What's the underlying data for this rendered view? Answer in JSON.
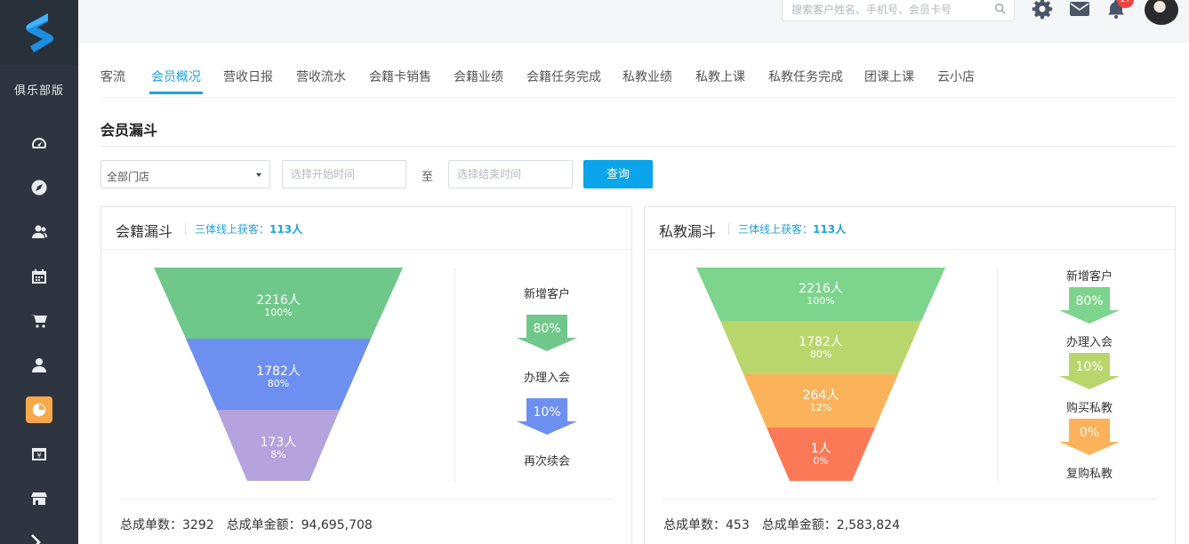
{
  "sidebar": {
    "brand": "俱乐部版",
    "items": [
      {
        "icon": "dashboard-icon"
      },
      {
        "icon": "compass-icon"
      },
      {
        "icon": "users-icon"
      },
      {
        "icon": "calendar-icon"
      },
      {
        "icon": "cart-icon"
      },
      {
        "icon": "user-icon"
      },
      {
        "icon": "report-icon",
        "active": true
      },
      {
        "icon": "finance-icon"
      },
      {
        "icon": "store-icon"
      }
    ]
  },
  "topbar": {
    "search_placeholder": "搜索客户姓名、手机号、会员卡号",
    "badge": "17"
  },
  "tabs": [
    {
      "label": "客流"
    },
    {
      "label": "会员概况",
      "active": true
    },
    {
      "label": "营收日报"
    },
    {
      "label": "营收流水"
    },
    {
      "label": "会籍卡销售"
    },
    {
      "label": "会籍业绩"
    },
    {
      "label": "会籍任务完成"
    },
    {
      "label": "私教业绩"
    },
    {
      "label": "私教上课"
    },
    {
      "label": "私教任务完成"
    },
    {
      "label": "团课上课"
    },
    {
      "label": "云小店"
    }
  ],
  "section_title": "会员漏斗",
  "filters": {
    "store_select": "全部门店",
    "start_placeholder": "选择开始时间",
    "to": "至",
    "end_placeholder": "选择结束时间",
    "query_button": "查询"
  },
  "membership_funnel": {
    "title": "会籍漏斗",
    "subtitle_label": "三体线上获客：",
    "subtitle_value": "113人",
    "segments": [
      {
        "count": "2216人",
        "percent": "100%",
        "color": "#70c78a"
      },
      {
        "count": "1782人",
        "percent": "80%",
        "color": "#6d8ff0"
      },
      {
        "count": "173人",
        "percent": "8%",
        "color": "#b4a3dc"
      }
    ],
    "steps": [
      "新增客户",
      "办理入会",
      "再次续会"
    ],
    "conversions": [
      {
        "value": "80%",
        "color": "#70c78a"
      },
      {
        "value": "10%",
        "color": "#6d8ff0"
      }
    ],
    "total_orders": "总成单数：3292",
    "total_amount": "总成单金额：94,695,708"
  },
  "pt_funnel": {
    "title": "私教漏斗",
    "subtitle_label": "三体线上获客：",
    "subtitle_value": "113人",
    "segments": [
      {
        "count": "2216人",
        "percent": "100%",
        "color": "#7dd48c"
      },
      {
        "count": "1782人",
        "percent": "80%",
        "color": "#b9d66c"
      },
      {
        "count": "264人",
        "percent": "12%",
        "color": "#fbb25a"
      },
      {
        "count": "1人",
        "percent": "0%",
        "color": "#fc7957"
      }
    ],
    "steps": [
      "新增客户",
      "办理入会",
      "购买私教",
      "复购私教"
    ],
    "conversions": [
      {
        "value": "80%",
        "color": "#7dd48c"
      },
      {
        "value": "10%",
        "color": "#b9d66c"
      },
      {
        "value": "0%",
        "color": "#fbb25a"
      }
    ],
    "total_orders": "总成单数：453",
    "total_amount": "总成单金额：2,583,824"
  }
}
